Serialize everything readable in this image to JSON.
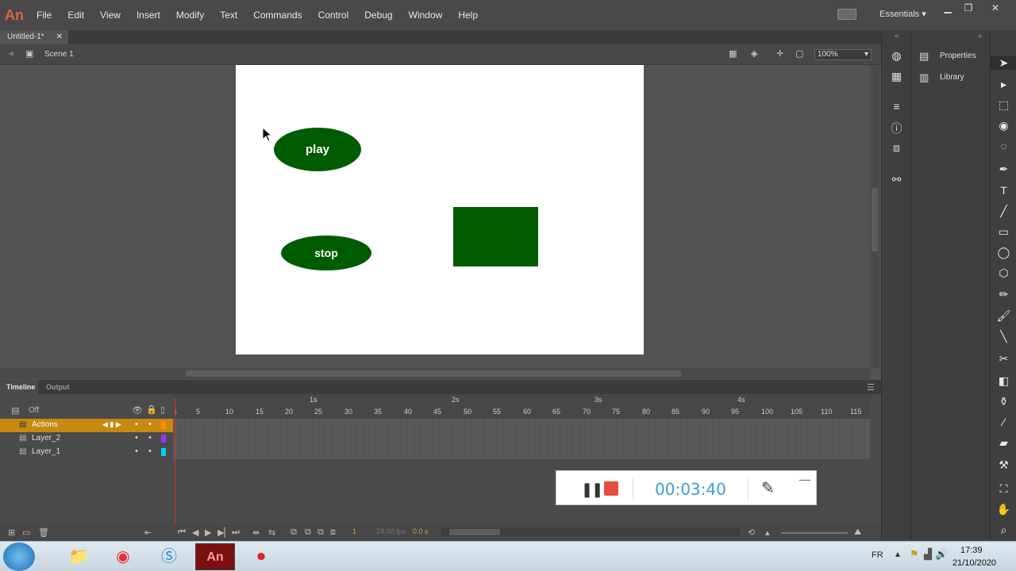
{
  "app": {
    "logo": "An",
    "doc_tab": "Untitled-1*",
    "close_glyph": "✕",
    "scene": "Scene 1",
    "zoom": "100%",
    "workspace": "Essentials"
  },
  "menu": [
    "File",
    "Edit",
    "View",
    "Insert",
    "Modify",
    "Text",
    "Commands",
    "Control",
    "Debug",
    "Window",
    "Help"
  ],
  "stage": {
    "play_label": "play",
    "stop_label": "stop",
    "fill_color": "#005c00"
  },
  "timeline": {
    "tabs": [
      "Timeline",
      "Output"
    ],
    "off_label": "Off",
    "seconds": [
      "1s",
      "2s",
      "3s",
      "4s"
    ],
    "frames": [
      "1",
      "5",
      "10",
      "15",
      "20",
      "25",
      "30",
      "35",
      "40",
      "45",
      "50",
      "55",
      "60",
      "65",
      "70",
      "75",
      "80",
      "85",
      "90",
      "95",
      "100",
      "105",
      "110",
      "115"
    ],
    "layers": [
      {
        "name": "Actions",
        "color": "#ff8c00",
        "selected": true
      },
      {
        "name": "Layer_2",
        "color": "#9b30ff",
        "selected": false
      },
      {
        "name": "Layer_1",
        "color": "#00d0ff",
        "selected": false
      }
    ],
    "footer": {
      "frame": "1",
      "fps": "24.00 fps",
      "time": "0.0 s"
    }
  },
  "recorder": {
    "time": "00:03:40"
  },
  "panels": {
    "properties": "Properties",
    "library": "Library"
  },
  "taskbar": {
    "lang": "FR",
    "time": "17:39",
    "date": "21/10/2020"
  }
}
